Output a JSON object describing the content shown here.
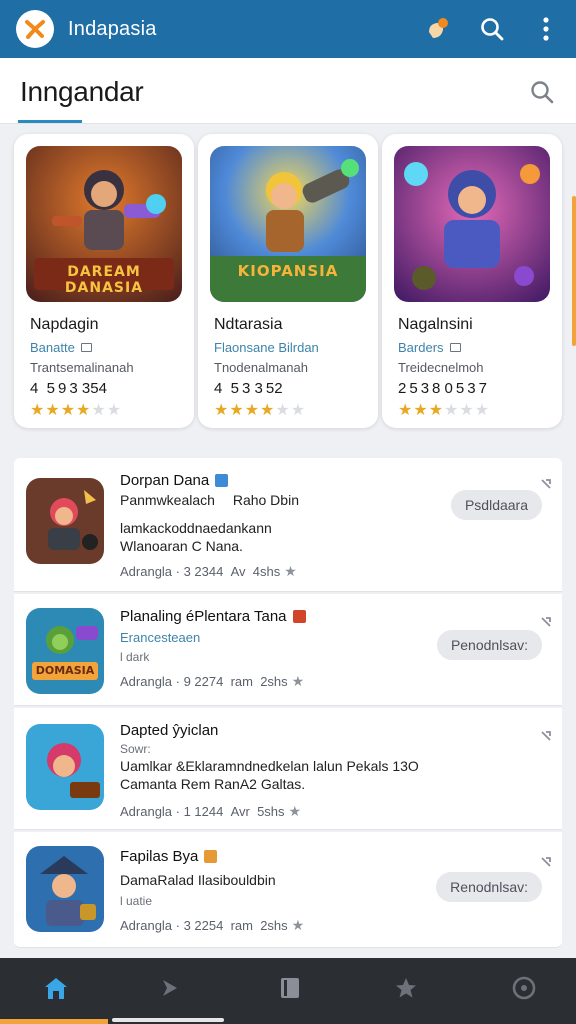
{
  "appbar": {
    "title": "Indapasia",
    "background": "#1f6ea6",
    "actions": [
      "notification-icon",
      "search-icon",
      "more-vert-icon"
    ]
  },
  "header": {
    "title": "Inngandar",
    "search_icon": "search-icon"
  },
  "featured": [
    {
      "name": "Napdagin",
      "genre": "Banatte",
      "developer": "Trantsemalinanah",
      "count": "4 5 9 3 354",
      "rating": 4,
      "art_text": "DAREAM DANASIA",
      "art_bg": "#7a3a26"
    },
    {
      "name": "Ndtarasia",
      "genre": "Flaonsane Bilrdan",
      "developer": "Tnodenalmanah",
      "count": "4 5 3 3 52",
      "rating": 4,
      "art_text": "KIOPANSIA",
      "art_bg": "#3f6fb4"
    },
    {
      "name": "Nagalnsini",
      "genre": "Barders",
      "developer": "Treidecnelmoh",
      "count": "2 5 3 8 0 5 3 7",
      "rating": 3,
      "art_text": "",
      "art_bg": "#5a2a86"
    }
  ],
  "list": [
    {
      "title": "Dorpan Dana",
      "tag_color": "#3d8ad6",
      "line1": "Panmwkealach  Raho Dbin",
      "sub": "",
      "line2": "lamkackoddnaedankann",
      "line3": "Wlanoaran C Nana.",
      "meta": "Adrangla · 3 2344  Av  4shs",
      "button": "Psdldaara"
    },
    {
      "title": "Planaling éPlentara Tana",
      "tag_color": "#d0452c",
      "line1": "",
      "sub": "Erancesteaen",
      "line2": "l dark",
      "line3": "",
      "meta": "Adrangla · 9 2274  ram  2shs",
      "button": "Penodnlsav:"
    },
    {
      "title": "Dapted ŷyiclan",
      "tag_color": "",
      "line1": "",
      "sub": "Sowr:",
      "line2": "Uamlkar &Eklaramndnedkelan lalun Pekals 13O",
      "line3": "Camanta Rem RanA2 Galtas.",
      "meta": "Adrangla · 1 1244  Avr  5shs",
      "button": ""
    },
    {
      "title": "Fapilas Bya",
      "tag_color": "#e69a35",
      "line1": "DamaRalad Ilasibouldbin",
      "sub": "",
      "line2": "l uatie",
      "line3": "",
      "meta": "Adrangla · 3 2254  ram  2shs",
      "button": "Renodnlsav:"
    }
  ],
  "bottom_nav": [
    "home-icon",
    "play-icon",
    "library-icon",
    "star-icon",
    "timer-icon"
  ]
}
